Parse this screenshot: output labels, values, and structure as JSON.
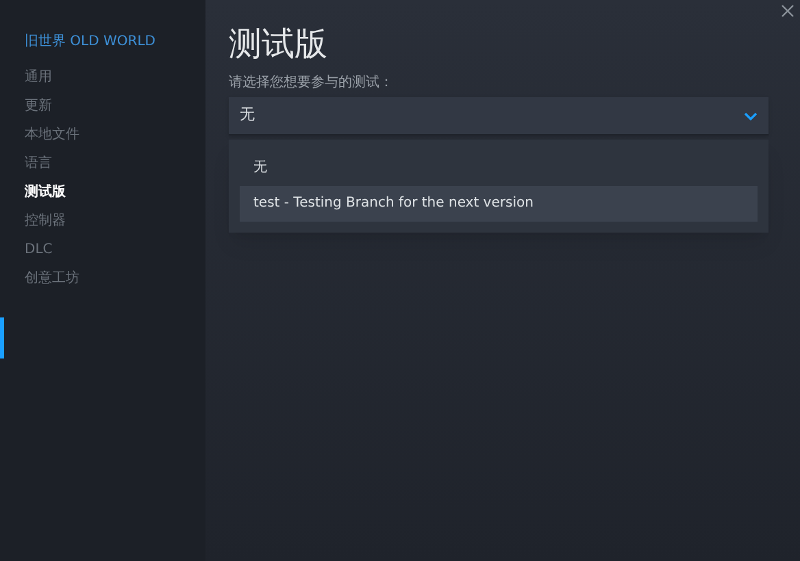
{
  "sidebar": {
    "game_title": "旧世界 OLD WORLD",
    "items": [
      {
        "label": "通用",
        "selected": false
      },
      {
        "label": "更新",
        "selected": false
      },
      {
        "label": "本地文件",
        "selected": false
      },
      {
        "label": "语言",
        "selected": false
      },
      {
        "label": "测试版",
        "selected": true
      },
      {
        "label": "控制器",
        "selected": false
      },
      {
        "label": "DLC",
        "selected": false
      },
      {
        "label": "创意工坊",
        "selected": false
      }
    ]
  },
  "main": {
    "title": "测试版",
    "prompt": "请选择您想要参与的测试：",
    "dropdown": {
      "value": "无",
      "expanded": true,
      "options": [
        {
          "label": "无",
          "highlighted": false
        },
        {
          "label": "test - Testing Branch for the next version",
          "highlighted": true
        }
      ]
    }
  }
}
